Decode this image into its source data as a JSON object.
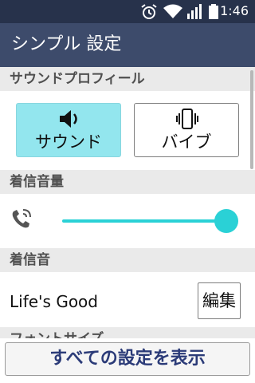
{
  "status_bar": {
    "time": "1:46",
    "icons": [
      "alarm-icon",
      "wifi-icon",
      "signal-icon",
      "battery-icon"
    ]
  },
  "app_bar": {
    "title": "シンプル 設定"
  },
  "sections": {
    "sound_profile": {
      "header": "サウンドプロフィール",
      "options": [
        {
          "label": "サウンド",
          "icon": "speaker-icon",
          "selected": true
        },
        {
          "label": "バイブ",
          "icon": "vibrate-icon",
          "selected": false
        }
      ]
    },
    "ringer_volume": {
      "header": "着信音量",
      "icon": "phone-ringing-icon",
      "level": 1.0
    },
    "ringtone": {
      "header": "着信音",
      "value": "Life's Good",
      "edit_label": "編集"
    },
    "font_size": {
      "header": "フォントサイズ"
    }
  },
  "footer": {
    "all_settings_label": "すべての設定を表示"
  },
  "colors": {
    "status_bar": "#27324b",
    "app_bar": "#3d4b6b",
    "accent": "#2ad1d6",
    "selected_option": "#93e6ee",
    "section_header": "#eaeaea",
    "footer_text": "#2b3b78"
  }
}
